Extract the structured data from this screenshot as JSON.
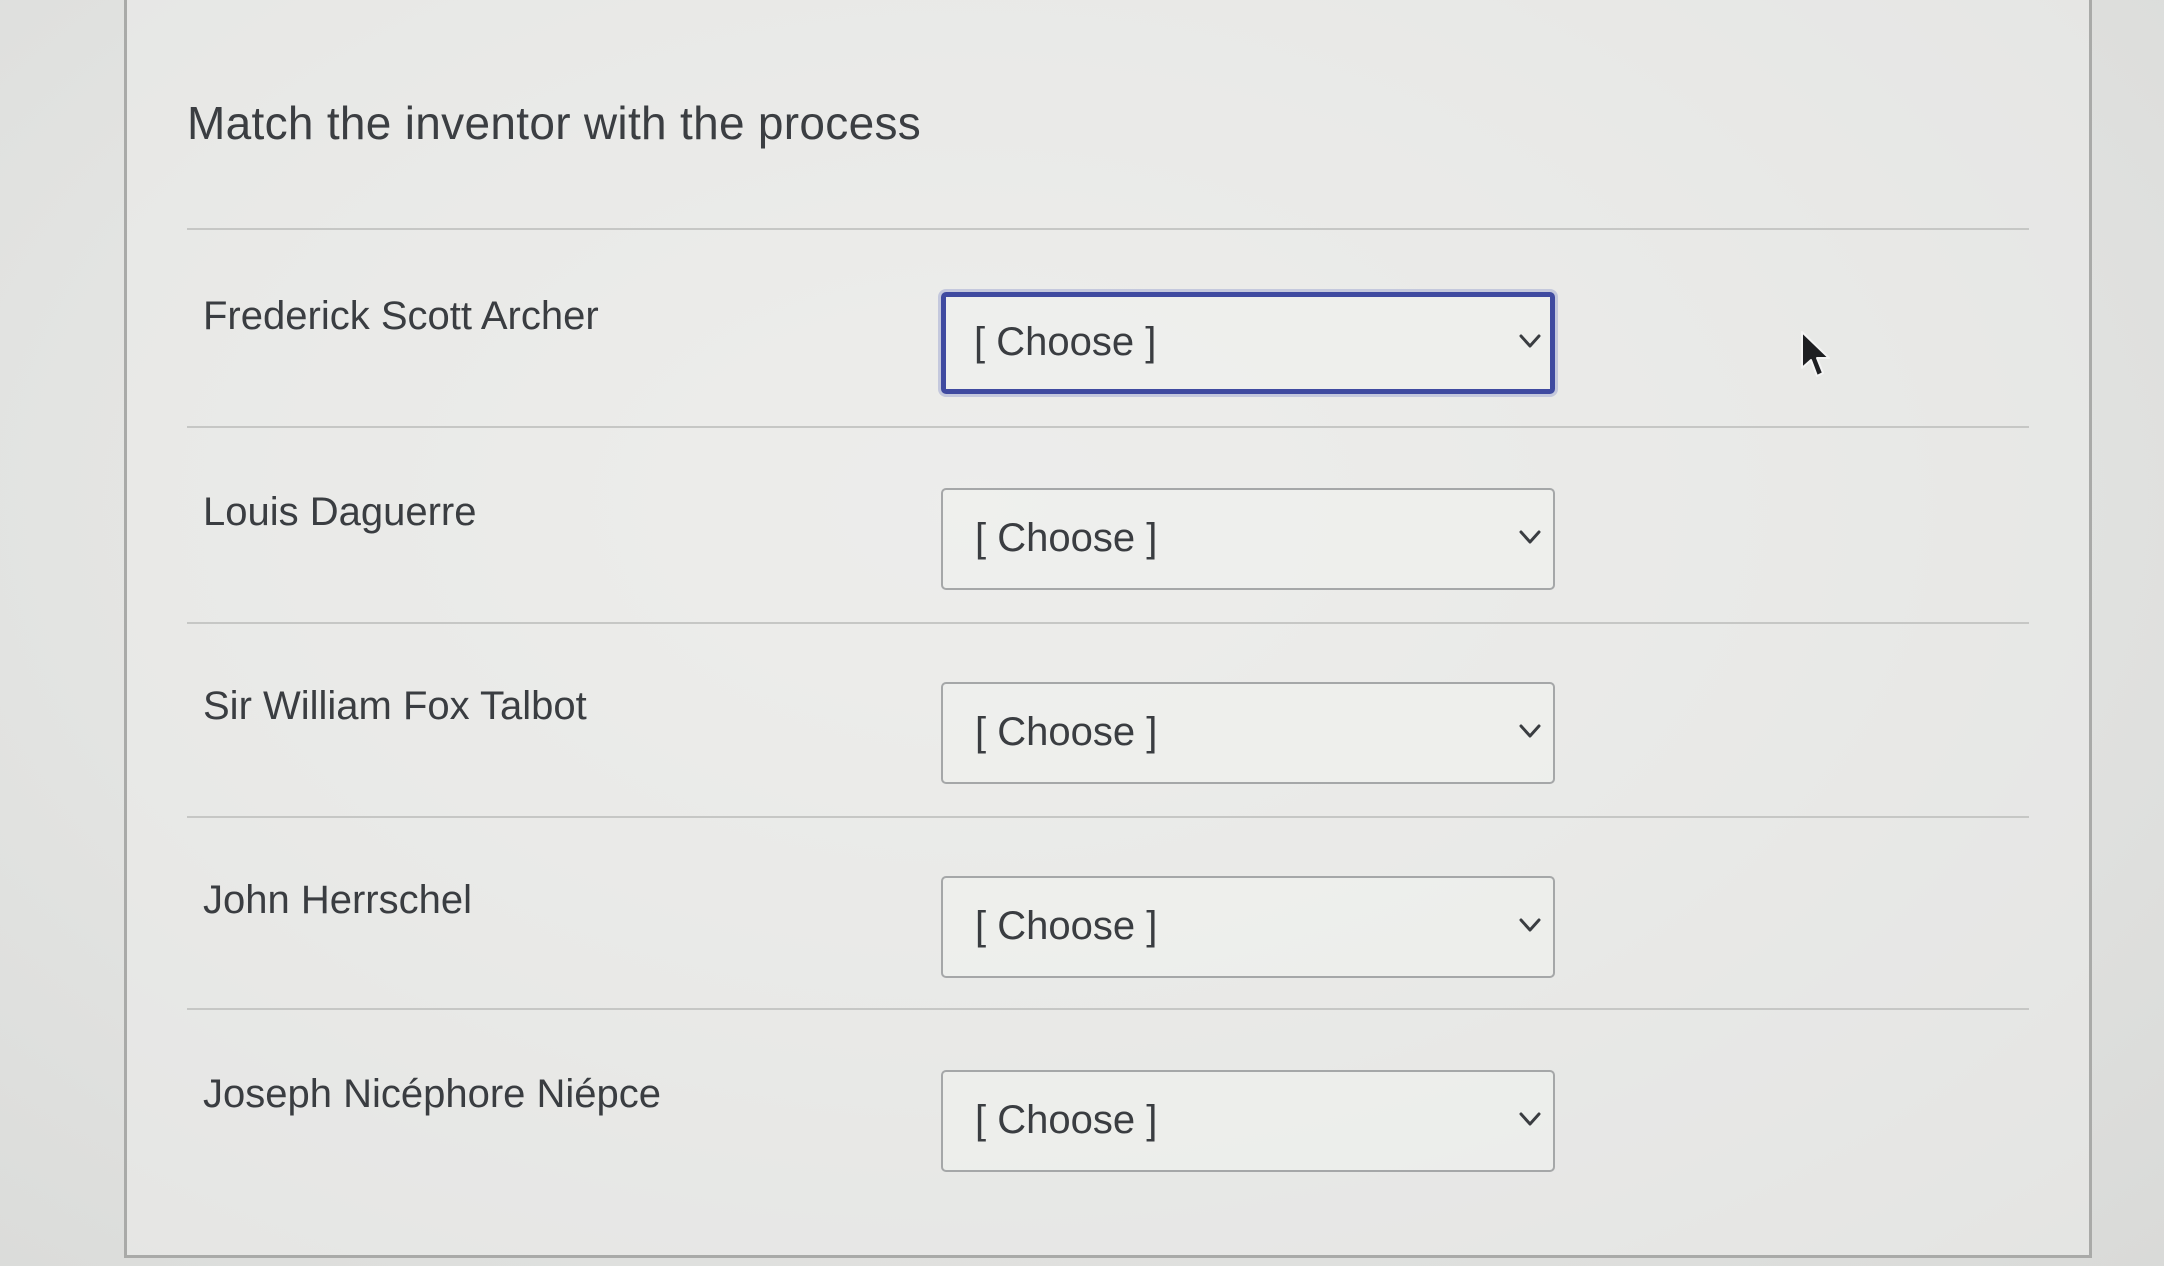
{
  "question": {
    "title": "Match the inventor with the process"
  },
  "matches": [
    {
      "inventor": "Frederick Scott Archer",
      "selected": "[ Choose ]",
      "focused": true
    },
    {
      "inventor": "Louis Daguerre",
      "selected": "[ Choose ]",
      "focused": false
    },
    {
      "inventor": "Sir William Fox Talbot",
      "selected": "[ Choose ]",
      "focused": false
    },
    {
      "inventor": "John Herrschel",
      "selected": "[ Choose ]",
      "focused": false
    },
    {
      "inventor": "Joseph Nicéphore Niépce",
      "selected": "[ Choose ]",
      "focused": false
    }
  ],
  "icons": {
    "dropdown": "chevron-down-icon",
    "pointer": "mouse-cursor-icon"
  },
  "colors": {
    "focus_border": "#3f4aa0",
    "text": "#3a3d41",
    "divider": "#c6c7c5"
  }
}
